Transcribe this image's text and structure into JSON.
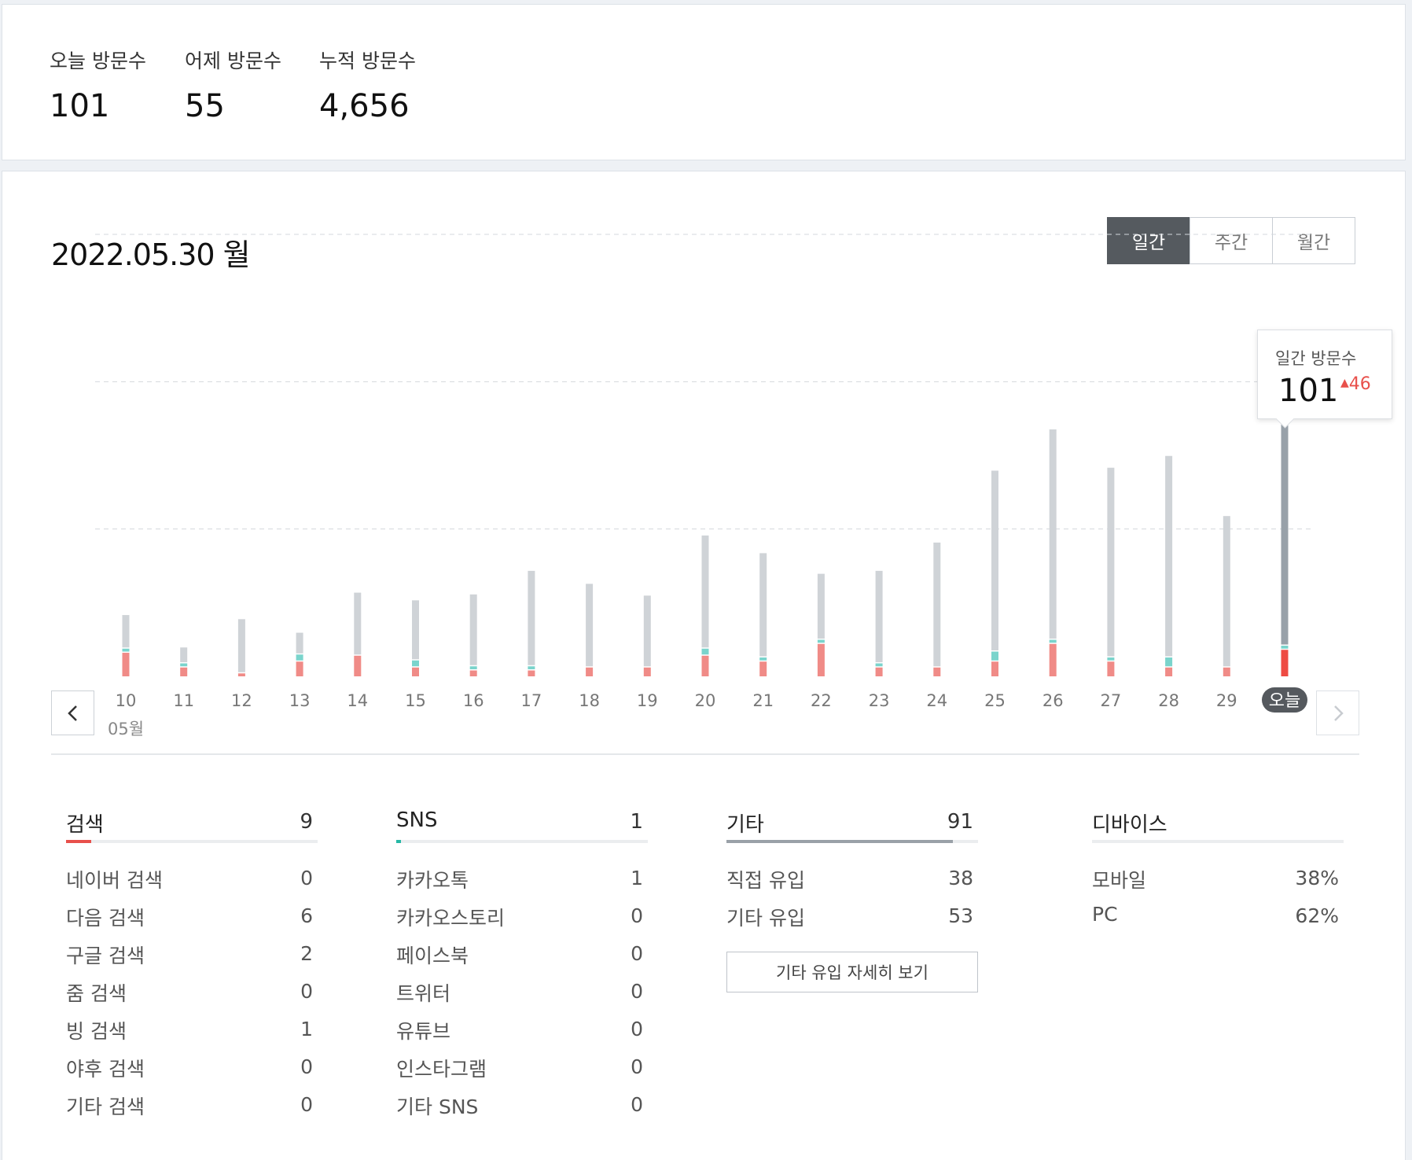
{
  "summary": {
    "today_label": "오늘 방문수",
    "today_value": "101",
    "yesterday_label": "어제 방문수",
    "yesterday_value": "55",
    "total_label": "누적 방문수",
    "total_value": "4,656"
  },
  "stats": {
    "date_title": "2022.05.30 월",
    "tabs": [
      "일간",
      "주간",
      "월간"
    ],
    "active_tab": "일간",
    "month_label": "05월",
    "prev_icon": "chevron-left-icon",
    "next_icon": "chevron-right-icon",
    "tooltip": {
      "label": "일간 방문수",
      "value": "101",
      "delta": "46"
    }
  },
  "colors": {
    "search": "#f08b87",
    "sns": "#7ad4cc",
    "other": "#cfd3d7",
    "today_other": "#98a1a9",
    "today_search": "#ee4b43",
    "accent_red": "#e8504b",
    "sns_teal": "#26b8a6",
    "other_gray": "#9aa1a8"
  },
  "chart_data": {
    "type": "bar",
    "stacked": true,
    "categories": [
      "10",
      "11",
      "12",
      "13",
      "14",
      "15",
      "16",
      "17",
      "18",
      "19",
      "20",
      "21",
      "22",
      "23",
      "24",
      "25",
      "26",
      "27",
      "28",
      "29",
      "오늘"
    ],
    "series": [
      {
        "name": "검색",
        "values": [
          8,
          3,
          1,
          5,
          7,
          3,
          2,
          2,
          3,
          3,
          7,
          5,
          11,
          3,
          3,
          5,
          11,
          5,
          3,
          3,
          9
        ]
      },
      {
        "name": "SNS",
        "values": [
          1,
          1,
          0,
          2,
          0,
          2,
          1,
          1,
          0,
          0,
          2,
          1,
          1,
          1,
          0,
          3,
          1,
          1,
          3,
          0,
          1
        ]
      },
      {
        "name": "기타",
        "values": [
          11,
          5,
          18,
          7,
          21,
          20,
          24,
          32,
          28,
          24,
          38,
          35,
          22,
          31,
          42,
          61,
          71,
          64,
          68,
          51,
          91
        ]
      }
    ],
    "ylim": [
      0,
      150
    ],
    "grid": true
  },
  "categories": [
    {
      "title": "검색",
      "total": "9",
      "bar_ratio": 0.1,
      "color_key": "accent_red",
      "rows": [
        {
          "label": "네이버 검색",
          "value": "0"
        },
        {
          "label": "다음 검색",
          "value": "6"
        },
        {
          "label": "구글 검색",
          "value": "2"
        },
        {
          "label": "줌 검색",
          "value": "0"
        },
        {
          "label": "빙 검색",
          "value": "1"
        },
        {
          "label": "야후 검색",
          "value": "0"
        },
        {
          "label": "기타 검색",
          "value": "0"
        }
      ]
    },
    {
      "title": "SNS",
      "total": "1",
      "bar_ratio": 0.02,
      "color_key": "sns_teal",
      "rows": [
        {
          "label": "카카오톡",
          "value": "1"
        },
        {
          "label": "카카오스토리",
          "value": "0"
        },
        {
          "label": "페이스북",
          "value": "0"
        },
        {
          "label": "트위터",
          "value": "0"
        },
        {
          "label": "유튜브",
          "value": "0"
        },
        {
          "label": "인스타그램",
          "value": "0"
        },
        {
          "label": "기타 SNS",
          "value": "0"
        }
      ]
    },
    {
      "title": "기타",
      "total": "91",
      "bar_ratio": 0.9,
      "color_key": "other_gray",
      "rows": [
        {
          "label": "직접 유입",
          "value": "38"
        },
        {
          "label": "기타 유입",
          "value": "53"
        }
      ],
      "button": "기타 유입 자세히 보기"
    },
    {
      "title": "디바이스",
      "total": "",
      "bar_ratio": 0,
      "color_key": "other_gray",
      "rows": [
        {
          "label": "모바일",
          "value": "38%"
        },
        {
          "label": "PC",
          "value": "62%"
        }
      ]
    }
  ]
}
